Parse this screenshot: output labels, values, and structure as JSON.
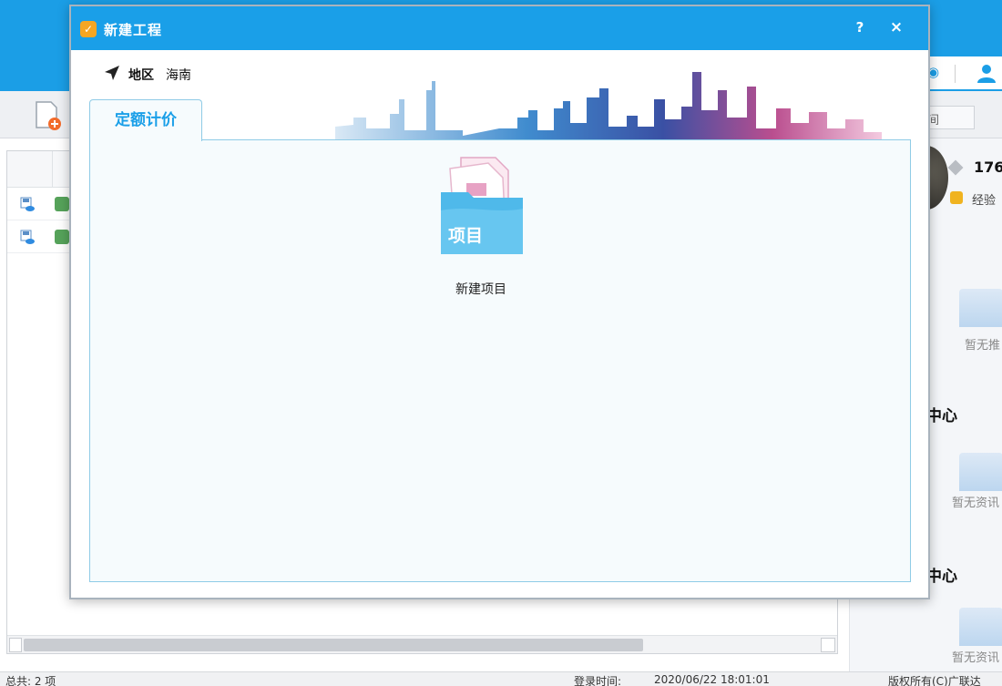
{
  "app": {
    "toolbar": {
      "workspace_tab": "空间"
    },
    "right_panel": {
      "points": "176",
      "exp_label": "经验",
      "recommend_empty": "暂无推",
      "section1_title": "中心",
      "section1_empty": "暂无资讯",
      "section2_title": "中心",
      "section2_empty": "暂无资讯"
    },
    "status_bar": {
      "total": "总共: 2 项",
      "login_label": "登录时间:",
      "login_time": "2020/06/22 18:01:01",
      "copyright": "版权所有(C)广联达"
    },
    "colors": {
      "titlebar": "#1a9fe8",
      "accent": "#1a9fe8"
    }
  },
  "dialog": {
    "title": "新建工程",
    "help_label": "?",
    "close_label": "×",
    "region_label": "地区",
    "region_value": "海南",
    "tabs": [
      "定额计价"
    ],
    "active_tab": "定额计价",
    "project_icon_text": "项目",
    "new_project_label": "新建项目",
    "icons": [
      "logo-icon",
      "location-arrow-icon",
      "folder-project-icon",
      "city-skyline-graphic"
    ]
  }
}
